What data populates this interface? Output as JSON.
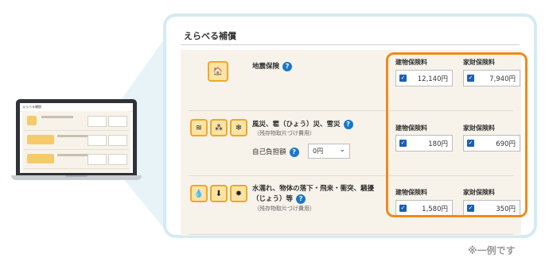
{
  "section_title": "えらべる補償",
  "premium_headers": {
    "building": "建物保険料",
    "contents": "家財保険料"
  },
  "rows": [
    {
      "title": "地震保険",
      "building": "12,140円",
      "contents": "7,940円"
    },
    {
      "title": "風災、雹（ひょう）災、雪災",
      "sub": "（残存物取片づけ費用）",
      "deductible_label": "自己負担額",
      "deductible_value": "0円",
      "building": "180円",
      "contents": "690円"
    },
    {
      "title_line1": "水濡れ、物体の落下・飛来・衝突、騒擾",
      "title_line2": "（じょう）等",
      "sub": "（残存物取片づけ費用）",
      "building": "1,580円",
      "contents": "350円"
    }
  ],
  "mini": {
    "title": "えらべる補償"
  },
  "note": "※一例です",
  "colors": {
    "accent": "#f08a1c",
    "help": "#1a78c8",
    "card_border": "#d5ebf3",
    "panel": "#f7f3ea"
  },
  "icons": [
    "earthquake-icon",
    "wind-icon",
    "hail-icon",
    "snow-icon",
    "water-icon",
    "falling-object-icon",
    "collision-icon"
  ]
}
